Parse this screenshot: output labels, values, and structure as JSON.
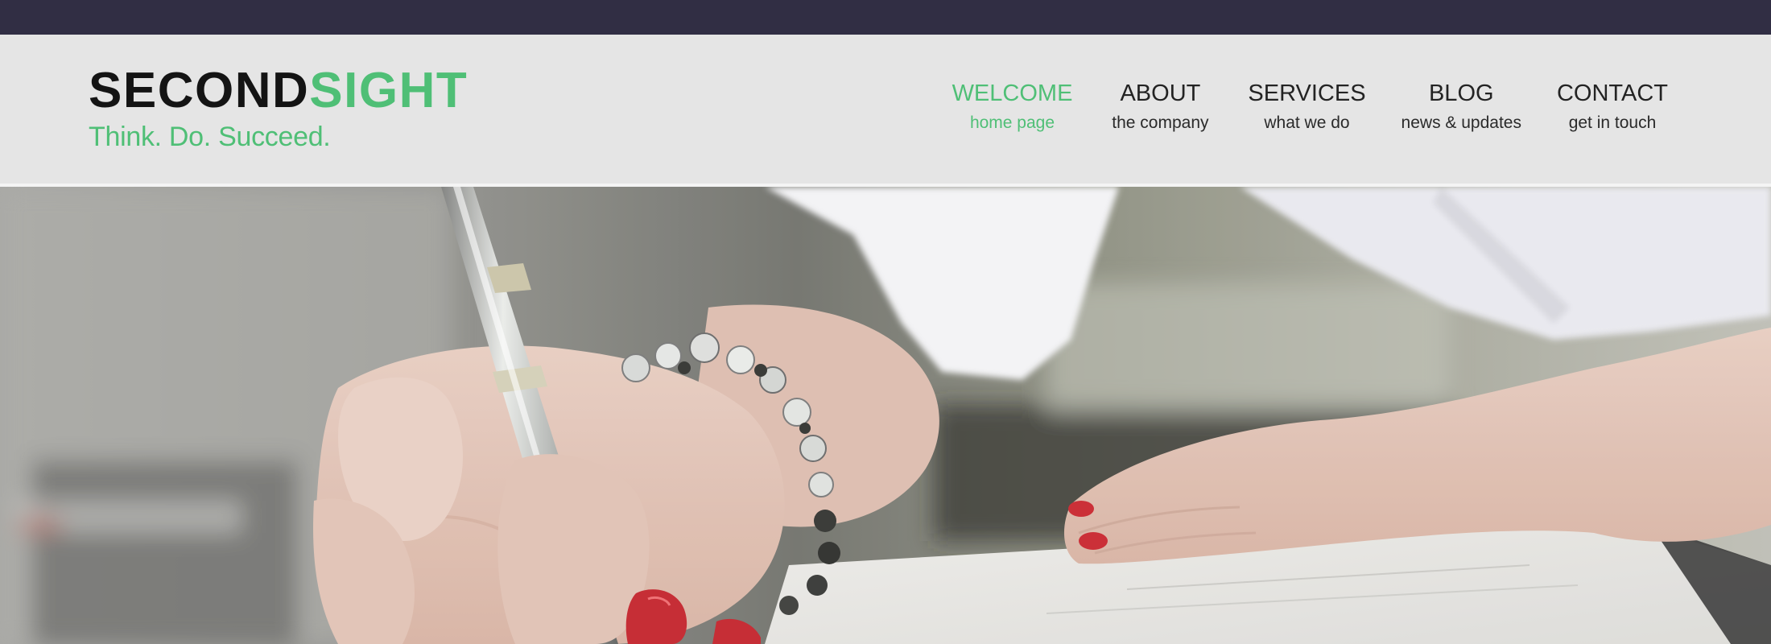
{
  "brand": {
    "name_part1": "SECOND",
    "name_part2": "SIGHT",
    "tagline": "Think. Do. Succeed.",
    "accent_color": "#4fbf76",
    "dark_color": "#141414"
  },
  "nav": {
    "items": [
      {
        "title": "WELCOME",
        "subtitle": "home page",
        "active": true
      },
      {
        "title": "ABOUT",
        "subtitle": "the company",
        "active": false
      },
      {
        "title": "SERVICES",
        "subtitle": "what we do",
        "active": false
      },
      {
        "title": "BLOG",
        "subtitle": "news & updates",
        "active": false
      },
      {
        "title": "CONTACT",
        "subtitle": "get in touch",
        "active": false
      }
    ]
  },
  "hero": {
    "image_description_icon": "hero-photo"
  },
  "colors": {
    "top_strip": "#312e44",
    "header_bg": "#e5e5e5"
  }
}
